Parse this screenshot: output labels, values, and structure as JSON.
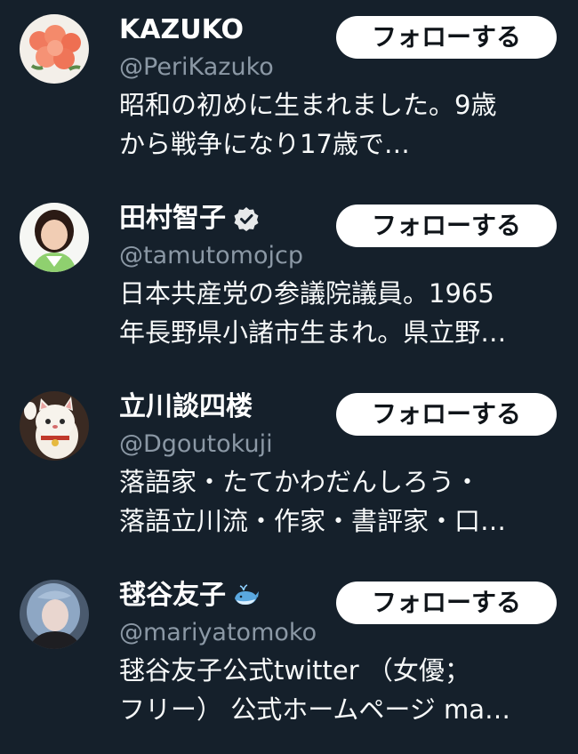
{
  "follow_label": "フォローする",
  "accounts": [
    {
      "name": "KAZUKO",
      "handle": "@PeriKazuko",
      "bio_lines": [
        "昭和の初めに生まれました。9歳",
        "から戦争になり17歳で…"
      ],
      "badge": null,
      "avatar_icon": "rose-bouquet-avatar"
    },
    {
      "name": "田村智子",
      "handle": "@tamutomojcp",
      "bio_lines": [
        "日本共産党の参議院議員。1965",
        "年長野県小諸市生まれ。県立野…"
      ],
      "badge": "verified-badge-icon",
      "avatar_icon": "portrait-avatar"
    },
    {
      "name": "立川談四楼",
      "handle": "@Dgoutokuji",
      "bio_lines": [
        "落語家・たてかわだんしろう・",
        "落語立川流・作家・書評家・口…"
      ],
      "badge": null,
      "avatar_icon": "maneki-neko-avatar"
    },
    {
      "name": "毬谷友子",
      "handle": "@mariyatomoko",
      "bio_lines": [
        "毬谷友子公式twitter （女優；",
        "フリー） 公式ホームページ ma…"
      ],
      "badge": "whale-emoji-icon",
      "avatar_icon": "portrait-blue-hair-avatar"
    }
  ],
  "colors": {
    "background": "#15202b",
    "handle": "#8b98a5",
    "button_bg": "#ffffff",
    "button_text": "#0f1419"
  }
}
